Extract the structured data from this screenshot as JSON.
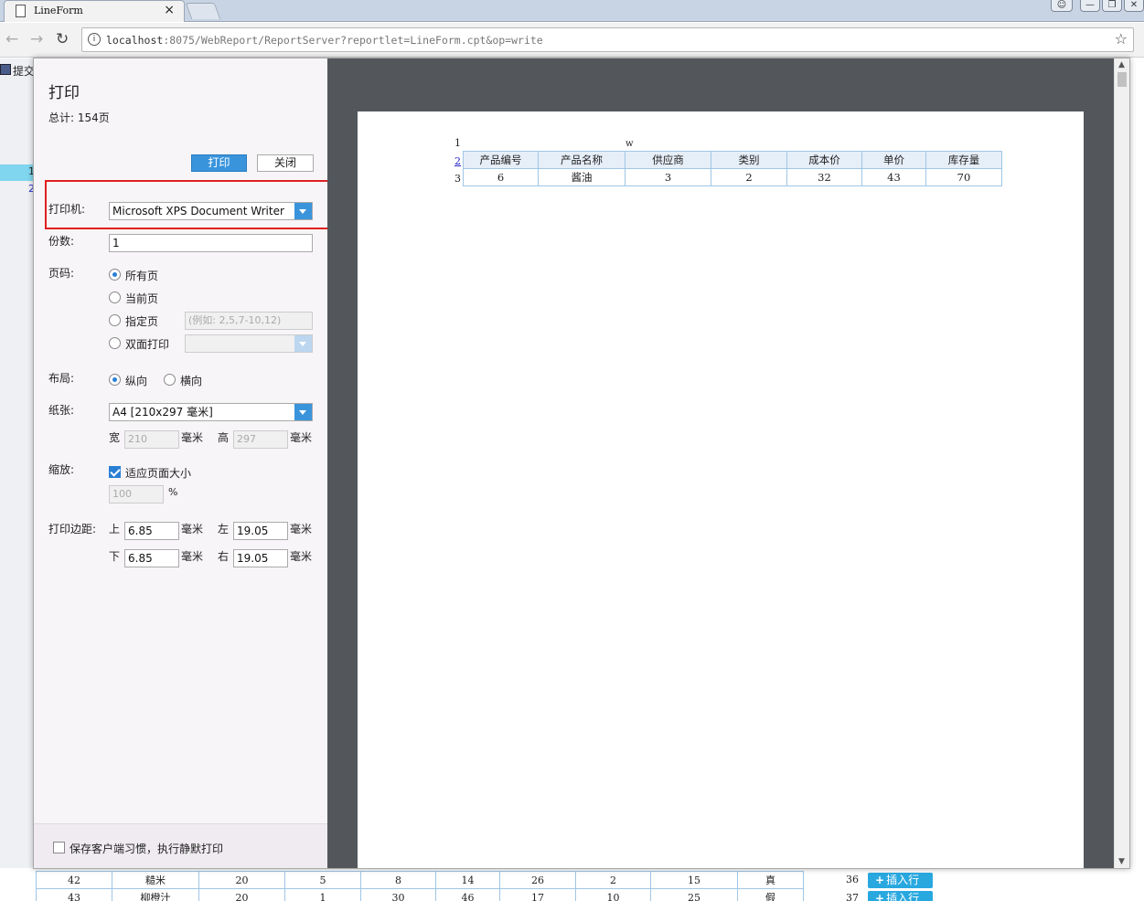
{
  "browser": {
    "tab_title": "LineForm",
    "tab_close": "×",
    "url_host": "localhost",
    "url_rest": ":8075/WebReport/ReportServer?reportlet=LineForm.cpt&op=write",
    "info_icon": "i",
    "star": "☆",
    "back": "←",
    "forward": "→",
    "reload": "↻"
  },
  "background": {
    "submit_label": "提交",
    "row_numbers": [
      "1",
      "2"
    ],
    "rows": [
      {
        "cells": [
          "42",
          "糙米",
          "20",
          "5",
          "8",
          "14",
          "26",
          "2",
          "15",
          "真"
        ],
        "index": "36",
        "insert_label": "插入行"
      },
      {
        "cells": [
          "43",
          "柳橙汁",
          "20",
          "1",
          "30",
          "46",
          "17",
          "10",
          "25",
          "假"
        ],
        "index": "37",
        "insert_label": "插入行"
      }
    ]
  },
  "dialog": {
    "title": "打印",
    "total": "总计: 154页",
    "print_button": "打印",
    "close_button": "关闭",
    "printer_label": "打印机:",
    "printer_value": "Microsoft XPS Document Writer",
    "copies_label": "份数:",
    "copies_value": "1",
    "pages_label": "页码:",
    "page_options": {
      "all": "所有页",
      "current": "当前页",
      "specified": "指定页",
      "specified_placeholder": "(例如: 2,5,7-10,12)",
      "duplex": "双面打印"
    },
    "layout_label": "布局:",
    "layout_portrait": "纵向",
    "layout_landscape": "横向",
    "paper_label": "纸张:",
    "paper_value": "A4 [210x297 毫米]",
    "width_label": "宽",
    "width_value": "210",
    "height_label": "高",
    "height_value": "297",
    "unit_mm": "毫米",
    "scale_label": "缩放:",
    "fit_page_label": "适应页面大小",
    "scale_value": "100",
    "percent": "%",
    "margin_label": "打印边距:",
    "margin_top_label": "上",
    "margin_top": "6.85",
    "margin_left_label": "左",
    "margin_left": "19.05",
    "margin_bottom_label": "下",
    "margin_bottom": "6.85",
    "margin_right_label": "右",
    "margin_right": "19.05",
    "save_habit_label": "保存客户端习惯，执行静默打印"
  },
  "preview": {
    "row_numbers": [
      "1",
      "2",
      "3"
    ],
    "w_cell": "w",
    "headers": [
      "产品编号",
      "产品名称",
      "供应商",
      "类别",
      "成本价",
      "单价",
      "库存量"
    ],
    "row": [
      "6",
      "酱油",
      "3",
      "2",
      "32",
      "43",
      "70"
    ]
  },
  "colors": {
    "accent": "#3a94dc",
    "highlight_border": "#e02020",
    "preview_bg": "#53575b",
    "insert_button": "#29a8e0"
  }
}
